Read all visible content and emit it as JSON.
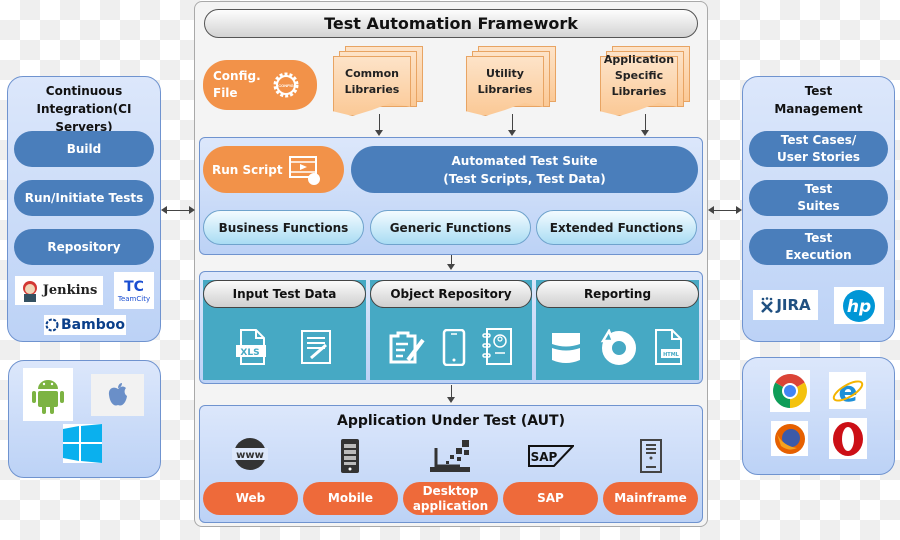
{
  "framework": {
    "title": "Test Automation Framework",
    "config": {
      "label_line1": "Config.",
      "label_line2": "File",
      "icon": "gear-config-icon",
      "icon_text": "CONFIG"
    },
    "libraries": [
      {
        "line1": "Common",
        "line2": "Libraries",
        "line3": ""
      },
      {
        "line1": "Utility",
        "line2": "Libraries",
        "line3": ""
      },
      {
        "line1": "Application",
        "line2": "Specific",
        "line3": "Libraries"
      }
    ],
    "run_script": {
      "label": "Run Script",
      "icon": "video-play-click-icon"
    },
    "automated_suite": {
      "line1": "Automated Test Suite",
      "line2": "(Test Scripts, Test Data)"
    },
    "functions": [
      "Business Functions",
      "Generic Functions",
      "Extended Functions"
    ],
    "data_groups": [
      {
        "title": "Input Test Data",
        "icons": [
          "xls-file-icon",
          "edit-document-icon"
        ],
        "xls_text": "XLS"
      },
      {
        "title": "Object Repository",
        "icons": [
          "form-edit-icon",
          "mobile-phone-icon",
          "address-book-icon"
        ]
      },
      {
        "title": "Reporting",
        "icons": [
          "database-icon",
          "pie-chart-icon",
          "html-file-icon"
        ],
        "html_text": "HTML"
      }
    ],
    "aut": {
      "title": "Application Under Test (AUT)",
      "items": [
        {
          "label_line1": "Web",
          "label_line2": "",
          "icon": "www-globe-icon",
          "icon_text": "www"
        },
        {
          "label_line1": "Mobile",
          "label_line2": "",
          "icon": "mobile-device-icon"
        },
        {
          "label_line1": "Desktop",
          "label_line2": "application",
          "icon": "laptop-icon"
        },
        {
          "label_line1": "SAP",
          "label_line2": "",
          "icon": "sap-logo-icon",
          "icon_text": "SAP"
        },
        {
          "label_line1": "Mainframe",
          "label_line2": "",
          "icon": "server-tower-icon"
        }
      ]
    }
  },
  "ci": {
    "title_line1": "Continuous",
    "title_line2": "Integration(CI Servers)",
    "buttons": [
      "Build",
      "Run/Initiate Tests",
      "Repository"
    ],
    "tools": {
      "jenkins": "Jenkins",
      "teamcity_mark": "TC",
      "teamcity": "TeamCity",
      "bamboo": "Bamboo"
    }
  },
  "platforms": {
    "icons": [
      "android-icon",
      "apple-icon",
      "windows-icon"
    ]
  },
  "test_management": {
    "title_line1": "Test",
    "title_line2": "Management",
    "buttons": [
      {
        "line1": "Test Cases/",
        "line2": "User Stories"
      },
      {
        "line1": "Test",
        "line2": "Suites"
      },
      {
        "line1": "Test",
        "line2": "Execution"
      }
    ],
    "tools": {
      "jira": "JIRA",
      "hp": "hp"
    }
  },
  "browsers": {
    "icons": [
      "chrome-icon",
      "internet-explorer-icon",
      "firefox-icon",
      "opera-icon"
    ]
  },
  "colors": {
    "orange": "#f29249",
    "aut_orange": "#ee6a3a",
    "dark_blue": "#4a7ebb",
    "teal": "#46a9c4",
    "light_blue": "#bcd2f6"
  }
}
